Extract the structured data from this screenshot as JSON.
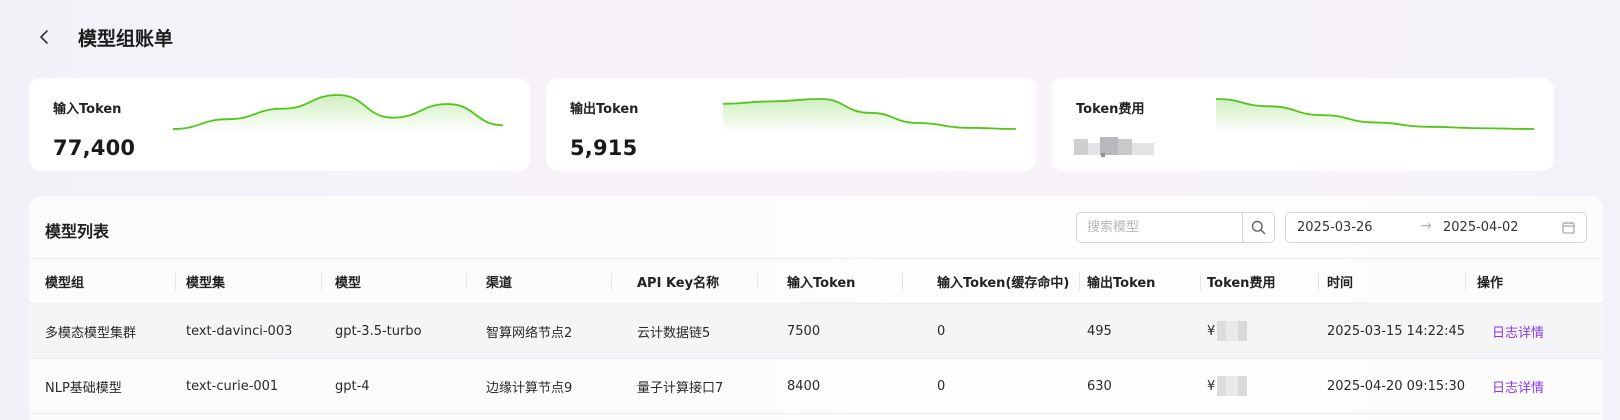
{
  "header": {
    "title": "模型组账单",
    "back_icon": "chevron-left-icon"
  },
  "cards": [
    {
      "label": "输入Token",
      "value": "77,400",
      "value_masked": false,
      "trend": [
        45,
        58,
        72,
        90,
        60,
        78,
        50
      ]
    },
    {
      "label": "输出Token",
      "value": "5,915",
      "value_masked": false,
      "trend": [
        100,
        104,
        108,
        85,
        68,
        60,
        58
      ]
    },
    {
      "label": "Token费用",
      "value": "",
      "value_masked": true,
      "trend": [
        100,
        90,
        78,
        68,
        62,
        60,
        59
      ]
    }
  ],
  "panel": {
    "title": "模型列表",
    "search_placeholder": "搜索模型",
    "search_icon": "search-icon",
    "date_start": "2025-03-26",
    "date_arrow": "→",
    "date_end": "2025-04-02",
    "calendar_icon": "calendar-icon"
  },
  "table": {
    "columns": [
      "模型组",
      "模型集",
      "模型",
      "渠道",
      "API Key名称",
      "输入Token",
      "输入Token(缓存命中)",
      "输出Token",
      "Token费用",
      "时间",
      "操作"
    ],
    "rows": [
      {
        "group": "多模态模型集群",
        "model_set": "text-davinci-003",
        "model": "gpt-3.5-turbo",
        "channel": "智算网络节点2",
        "api_key": "云计数据链5",
        "input_token": "7500",
        "cached_input_token": "0",
        "output_token": "495",
        "fee_symbol": "¥",
        "time": "2025-03-15 14:22:45",
        "action": "日志详情"
      },
      {
        "group": "NLP基础模型",
        "model_set": "text-curie-001",
        "model": "gpt-4",
        "channel": "边缘计算节点9",
        "api_key": "量子计算接口7",
        "input_token": "8400",
        "cached_input_token": "0",
        "output_token": "630",
        "fee_symbol": "¥",
        "time": "2025-04-20 09:15:30",
        "action": "日志详情"
      }
    ]
  },
  "colors": {
    "accent_green": "#52c41a",
    "link_purple": "#8b3ae6",
    "background": "#f4f2f8"
  }
}
